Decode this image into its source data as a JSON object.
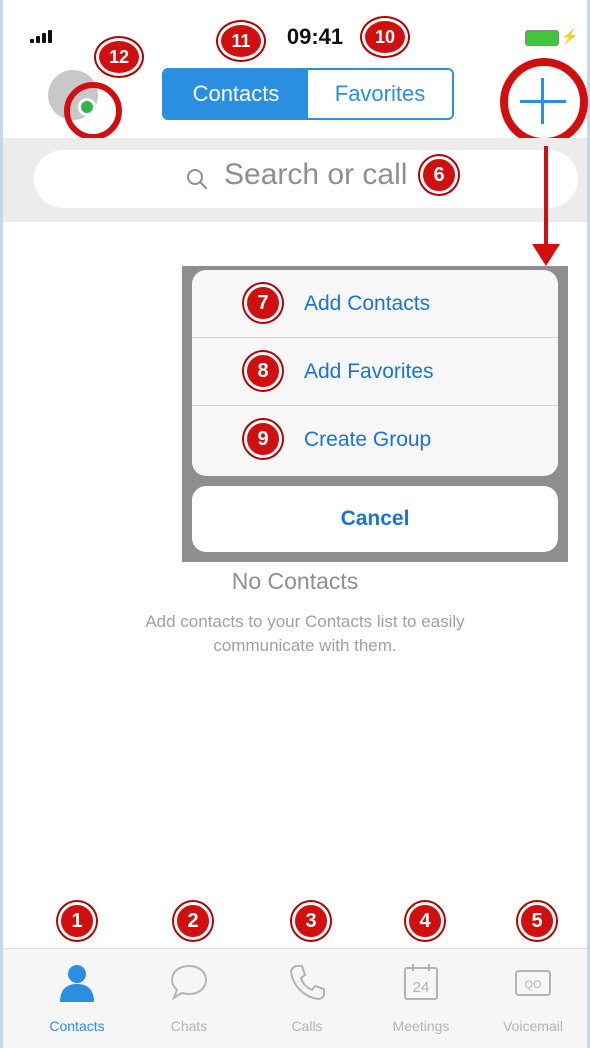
{
  "status_bar": {
    "time": "09:41"
  },
  "header": {
    "tabs": [
      {
        "label": "Contacts"
      },
      {
        "label": "Favorites"
      }
    ]
  },
  "search": {
    "placeholder": "Search or call"
  },
  "action_sheet": {
    "items": [
      {
        "label": "Add Contacts"
      },
      {
        "label": "Add Favorites"
      },
      {
        "label": "Create Group"
      }
    ],
    "cancel_label": "Cancel"
  },
  "empty_state": {
    "title": "No Contacts",
    "description": "Add contacts to your Contacts list to easily communicate with them."
  },
  "tab_bar": {
    "items": [
      {
        "label": "Contacts",
        "icon": "person-icon"
      },
      {
        "label": "Chats",
        "icon": "chat-bubble-icon"
      },
      {
        "label": "Calls",
        "icon": "phone-icon"
      },
      {
        "label": "Meetings",
        "icon": "calendar-icon",
        "day": "24"
      },
      {
        "label": "Voicemail",
        "icon": "voicemail-icon",
        "glyph": "QO"
      }
    ]
  },
  "annotations": [
    {
      "number": "1"
    },
    {
      "number": "2"
    },
    {
      "number": "3"
    },
    {
      "number": "4"
    },
    {
      "number": "5"
    },
    {
      "number": "6"
    },
    {
      "number": "7"
    },
    {
      "number": "8"
    },
    {
      "number": "9"
    },
    {
      "number": "10"
    },
    {
      "number": "11"
    },
    {
      "number": "12"
    }
  ],
  "colors": {
    "accent": "#2a8fe0",
    "annotation_red": "#d20f0f",
    "presence_green": "#31b54a"
  }
}
